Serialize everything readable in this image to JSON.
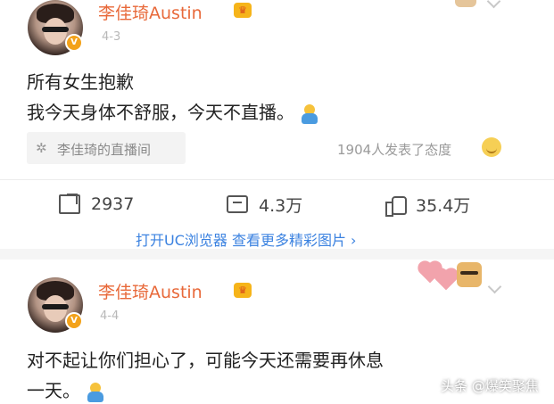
{
  "post1": {
    "username": "李佳琦Austin",
    "time": "4-3",
    "line1": "所有女生抱歉",
    "line2": "我今天身体不舒服，今天不直播。",
    "source": "李佳琦的直播间",
    "attitude": "1904人发表了态度",
    "actions": {
      "repost": "2937",
      "comment": "4.3万",
      "like": "35.4万"
    },
    "uc_link": "打开UC浏览器 查看更多精彩图片 ›"
  },
  "post2": {
    "username": "李佳琦Austin",
    "time": "4-4",
    "line1": "对不起让你们担心了，可能今天还需要再休息",
    "line2": "一天。"
  },
  "watermark": "头条 @爆笑聚焦",
  "colors": {
    "name": "#e8693a",
    "link": "#3b82e0"
  },
  "icons": [
    "avatar-image",
    "verified-badge-icon",
    "crown-icon",
    "chevron-down-icon",
    "emoji-person-icon",
    "live-icon",
    "smile-emoji-icon",
    "share-icon",
    "comment-icon",
    "like-icon",
    "heart-icon",
    "sticker-icon"
  ]
}
